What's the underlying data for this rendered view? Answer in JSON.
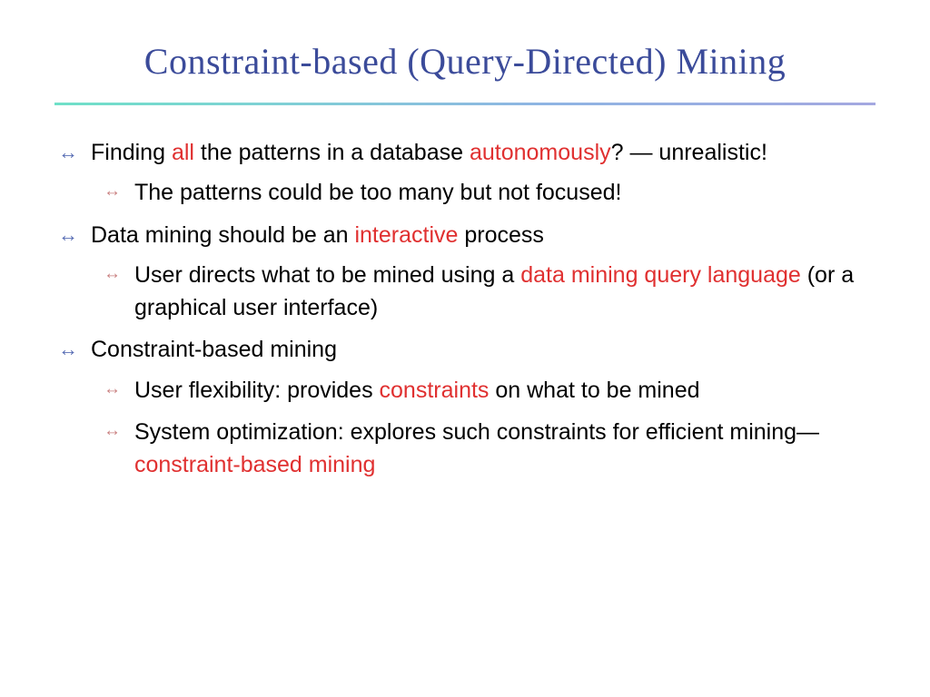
{
  "title": "Constraint-based (Query-Directed) Mining",
  "b1": {
    "p1": "Finding ",
    "hl1": "all",
    "p2": " the patterns in a database ",
    "hl2": "autonomously",
    "p3": "? — unrealistic!",
    "sub1": "The patterns could be too many but not focused!"
  },
  "b2": {
    "p1": "Data mining should be an ",
    "hl1": "interactive",
    "p2": " process",
    "sub1p1": "User directs what to be mined using a ",
    "sub1hl": "data mining query language",
    "sub1p2": " (or a graphical user interface)"
  },
  "b3": {
    "p1": "Constraint-based mining",
    "sub1p1": "User flexibility: provides ",
    "sub1hl": "constraints",
    "sub1p2": " on what to be mined",
    "sub2p1": "System optimization: explores such constraints for efficient mining—",
    "sub2hl": "constraint-based mining"
  }
}
